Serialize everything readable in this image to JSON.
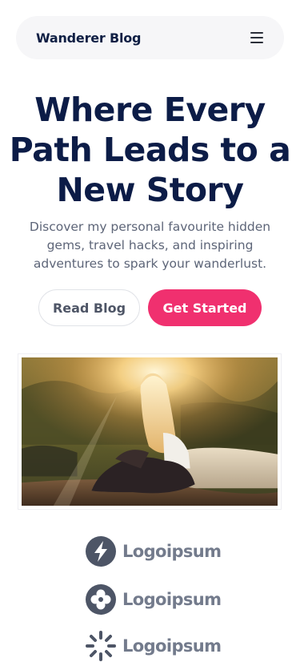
{
  "navbar": {
    "brand": "Wanderer Blog",
    "menu_icon": "hamburger-menu-icon"
  },
  "hero": {
    "title": "Where Every Path Leads to a New Story",
    "subtitle": "Discover my personal favourite hidden gems, travel hacks, and inspiring adventures to spark your wanderlust.",
    "secondary_button": "Read Blog",
    "primary_button": "Get Started",
    "image_icon": "woman-sitting-by-lake-sunset-photo"
  },
  "logos": [
    {
      "name": "Logoipsum",
      "icon": "lightning-bolt-icon"
    },
    {
      "name": "Logoipsum",
      "icon": "four-leaf-clover-icon"
    },
    {
      "name": "Logoipsum",
      "icon": "sunburst-icon"
    }
  ],
  "colors": {
    "accent": "#f0306f",
    "heading": "#0c1c47",
    "body_text": "#5d6578",
    "nav_bg": "#f6f6f8",
    "logo_gray": "#737b8c"
  }
}
